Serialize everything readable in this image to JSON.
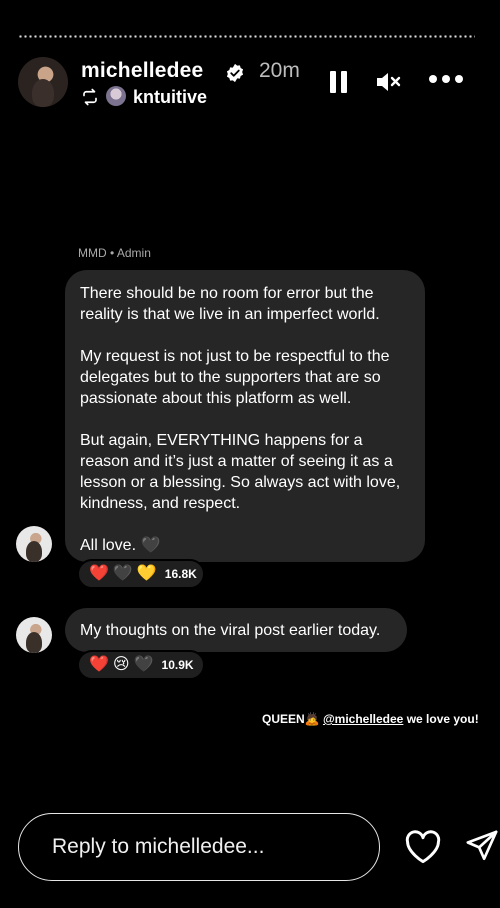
{
  "story": {
    "username": "michelledee",
    "time": "20m",
    "reposted_from": "kntuitive"
  },
  "message_group": {
    "sender_label": "MMD • Admin",
    "message1": {
      "paragraphs": [
        "There should be no room for error but the reality is that we live in an imperfect world.",
        "My request is not just to be respectful to the delegates but to the supporters that are so passionate about this platform as well.",
        "But again, EVERYTHING happens for a reason and it’s just a matter of seeing it as a lesson or a blessing. So always act with love, kindness, and respect.",
        "All love. 🖤"
      ],
      "reactions": [
        "❤️",
        "🖤",
        "💛"
      ],
      "reaction_count": "16.8K"
    },
    "message2": {
      "text": "My thoughts on the viral post earlier today.",
      "reactions": [
        "❤️",
        "😢",
        "🖤"
      ],
      "reaction_count": "10.9K"
    }
  },
  "mention_caption": {
    "prefix": "QUEEN🙇 ",
    "handle": "@michelledee",
    "suffix": " we love you!"
  },
  "reply": {
    "placeholder": "Reply to michelledee..."
  },
  "icons": [
    "verified-icon",
    "repost-icon",
    "pause-icon",
    "mute-icon",
    "more-icon",
    "heart-icon",
    "send-icon"
  ]
}
